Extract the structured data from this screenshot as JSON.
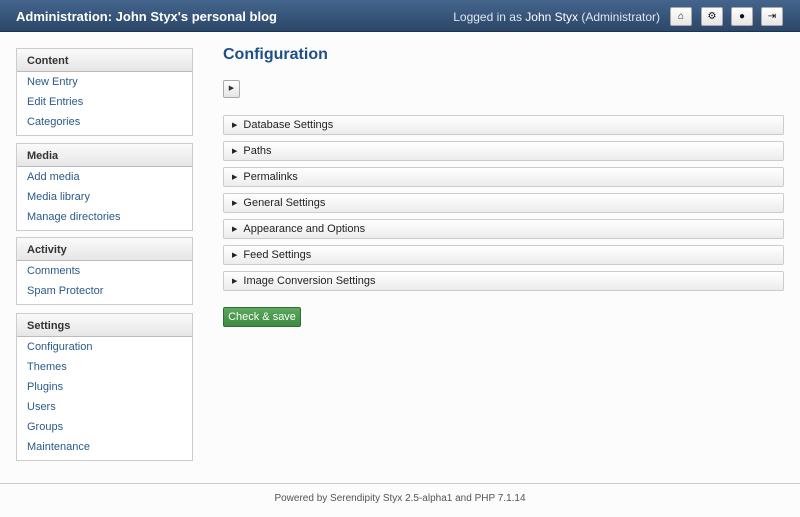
{
  "header": {
    "title": "Administration: John Styx's personal blog",
    "logged_in_prefix": "Logged in as ",
    "user": "John Styx",
    "role": " (Administrator)",
    "buttons": [
      {
        "icon": "home-icon",
        "glyph": "⌂"
      },
      {
        "icon": "gears-icon",
        "glyph": "⚙"
      },
      {
        "icon": "globe-icon",
        "glyph": "●"
      },
      {
        "icon": "logout-icon",
        "glyph": "⇥"
      }
    ]
  },
  "sidebar": [
    {
      "title": "Content",
      "items": [
        "New Entry",
        "Edit Entries",
        "Categories"
      ]
    },
    {
      "title": "Media",
      "items": [
        "Add media",
        "Media library",
        "Manage directories"
      ]
    },
    {
      "title": "Activity",
      "items": [
        "Comments",
        "Spam Protector"
      ]
    },
    {
      "title": "Settings",
      "items": [
        "Configuration",
        "Themes",
        "Plugins",
        "Users",
        "Groups",
        "Maintenance"
      ]
    }
  ],
  "main": {
    "title": "Configuration",
    "sections": [
      "Database Settings",
      "Paths",
      "Permalinks",
      "General Settings",
      "Appearance and Options",
      "Feed Settings",
      "Image Conversion Settings"
    ],
    "save_label": "Check & save"
  },
  "footer": {
    "text": "Powered by Serendipity Styx 2.5-alpha1 and PHP 7.1.14"
  },
  "colors": {
    "header": "#2b4769",
    "title": "#1e4f86",
    "link": "#2b5a8a",
    "save": "#4a9a4d"
  }
}
